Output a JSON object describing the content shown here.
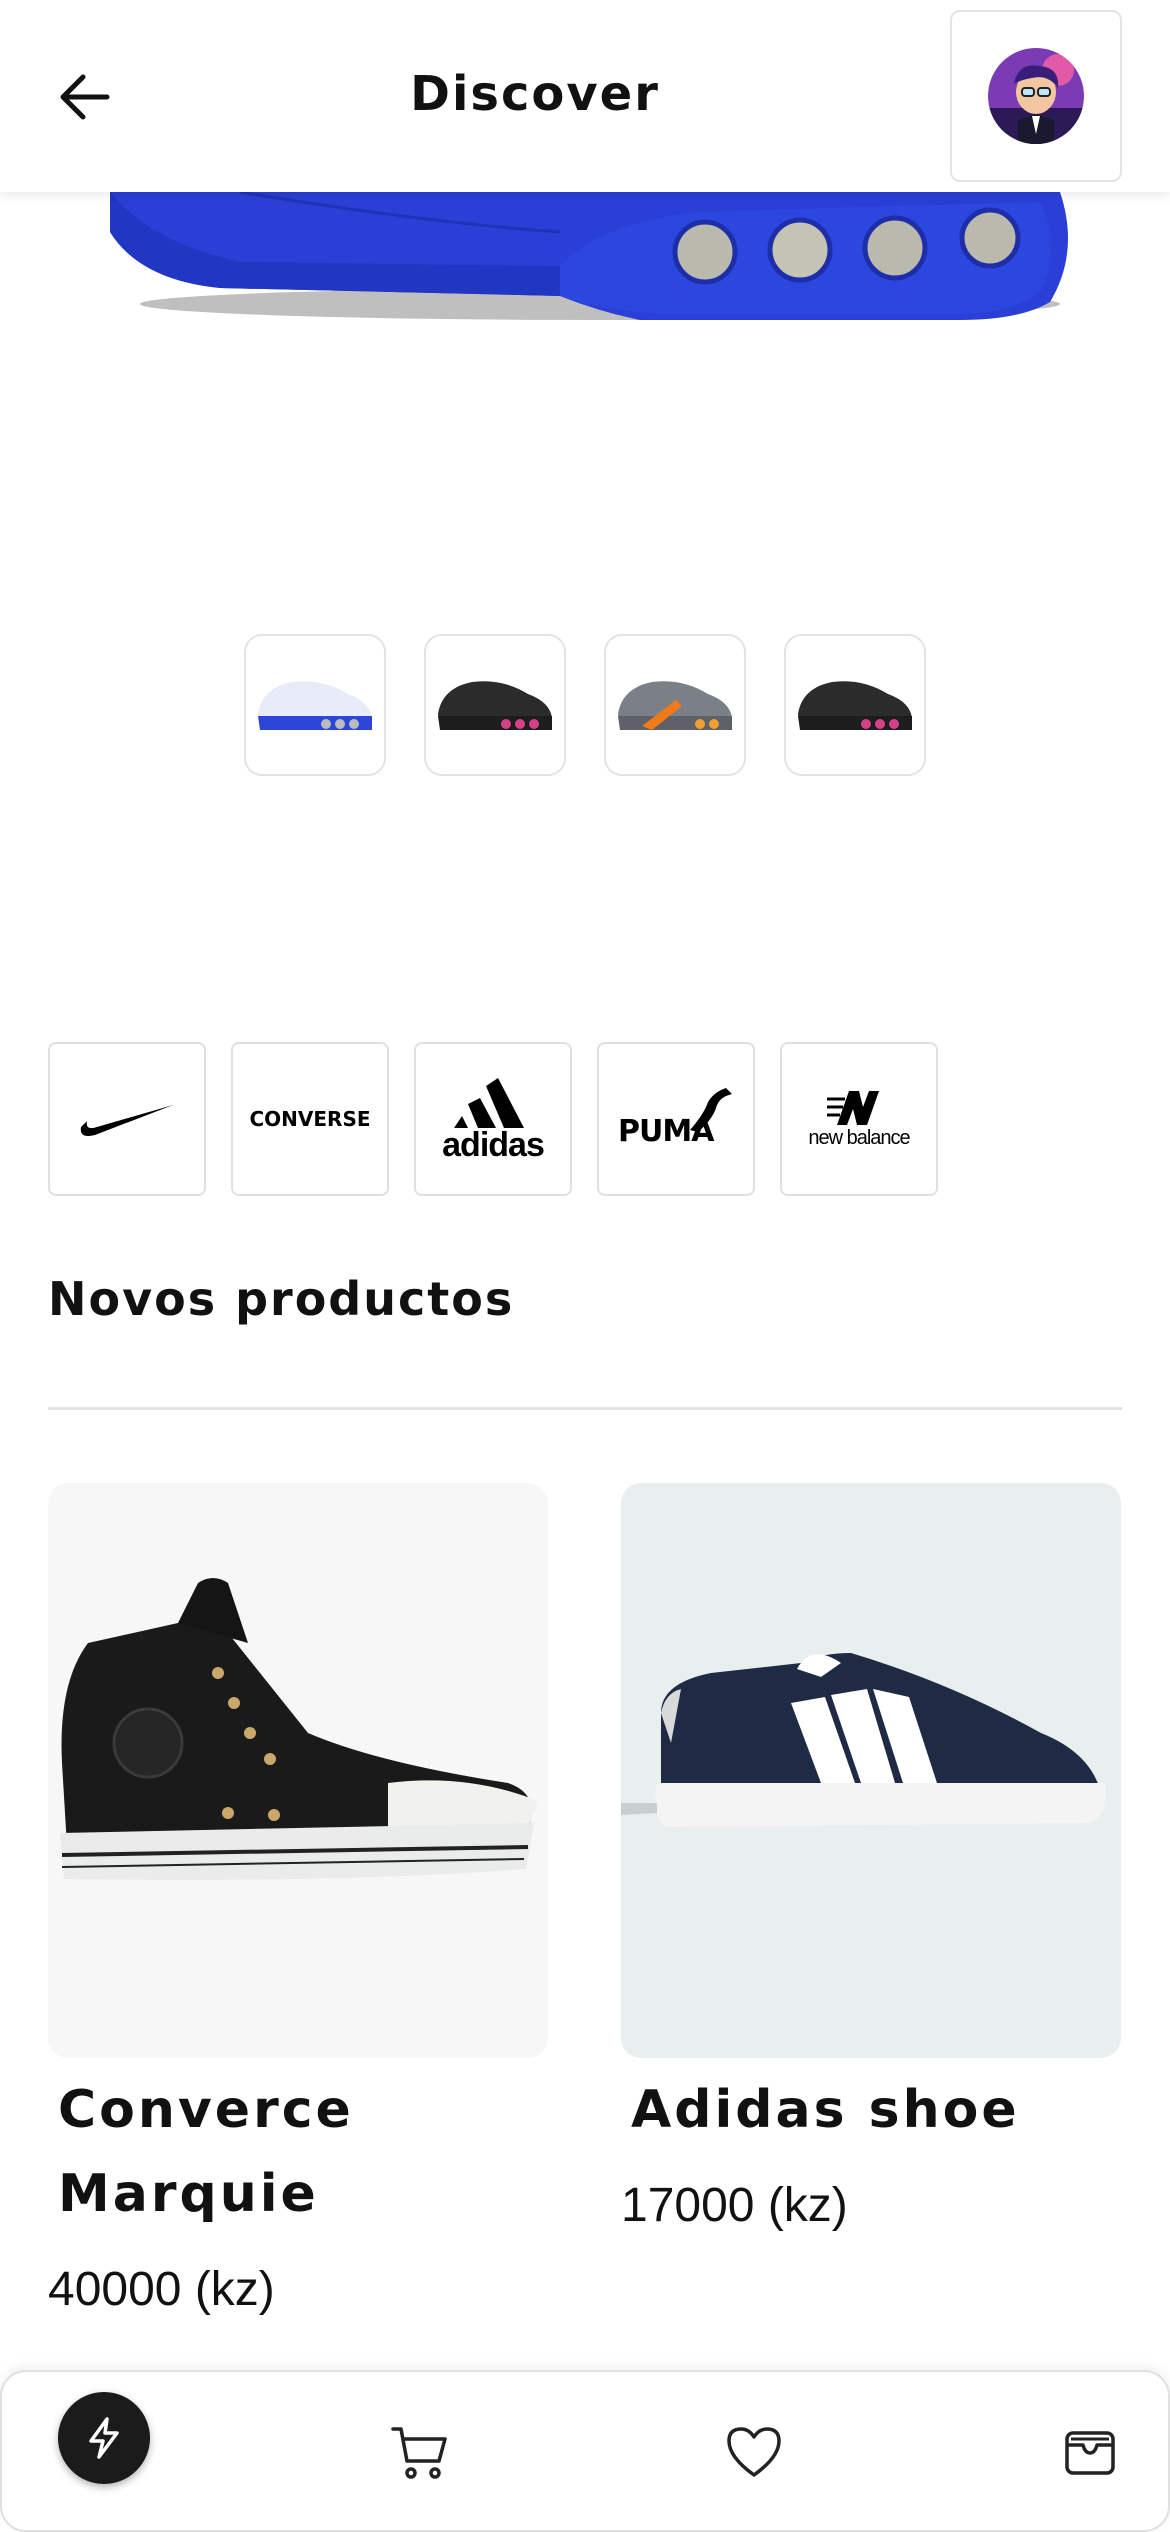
{
  "header": {
    "title": "Discover"
  },
  "icons": {
    "back": "arrow-left-icon",
    "avatar": "user-avatar",
    "nav_home": "lightning-icon",
    "nav_cart": "cart-icon",
    "nav_favorites": "heart-icon",
    "nav_wallet": "wallet-icon"
  },
  "hero": {
    "thumbnails": [
      "blue-white sneaker",
      "black-pink sneaker",
      "grey-orange sneaker",
      "black-pink sneaker"
    ]
  },
  "brands": [
    {
      "name": "Nike",
      "logo_text": ""
    },
    {
      "name": "Converse",
      "logo_text": "CONVERSE"
    },
    {
      "name": "Adidas",
      "logo_text": "adidas"
    },
    {
      "name": "Puma",
      "logo_text": "PUMA"
    },
    {
      "name": "New Balance",
      "logo_text": "new balance"
    }
  ],
  "section": {
    "title": "Novos productos"
  },
  "products": [
    {
      "name_line1": "Converce",
      "name_line2": "Marquie",
      "price": "40000 (kz)"
    },
    {
      "name_line1": "Adidas shoe",
      "price": "17000 (kz)"
    }
  ],
  "colors": {
    "accent": "#1b1b1b",
    "hero_blue": "#2a3fd6",
    "card_bg_1": "#f7f7f7",
    "card_bg_2": "#e9eeee"
  }
}
